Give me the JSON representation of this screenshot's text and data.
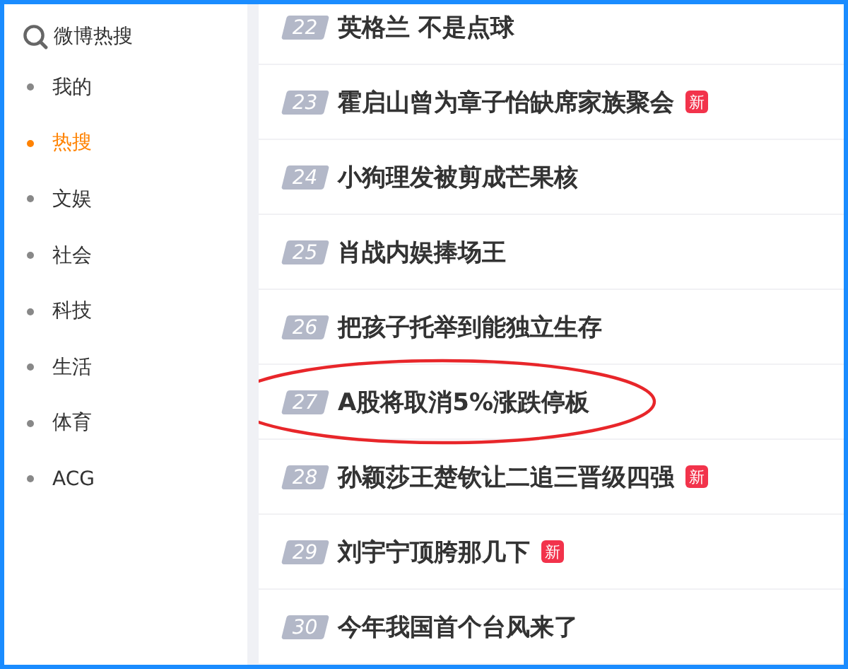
{
  "sidebar": {
    "title": "微博热搜",
    "items": [
      {
        "label": "我的",
        "selected": false
      },
      {
        "label": "热搜",
        "selected": true
      },
      {
        "label": "文娱",
        "selected": false
      },
      {
        "label": "社会",
        "selected": false
      },
      {
        "label": "科技",
        "selected": false
      },
      {
        "label": "生活",
        "selected": false
      },
      {
        "label": "体育",
        "selected": false
      },
      {
        "label": "ACG",
        "selected": false
      }
    ]
  },
  "hot_list": [
    {
      "rank": "22",
      "title": "英格兰 不是点球",
      "highlighted": false
    },
    {
      "rank": "23",
      "title": "霍启山曾为章子怡缺席家族聚会",
      "badge": "新",
      "highlighted": false
    },
    {
      "rank": "24",
      "title": "小狗理发被剪成芒果核",
      "highlighted": false
    },
    {
      "rank": "25",
      "title": "肖战内娱捧场王",
      "highlighted": false
    },
    {
      "rank": "26",
      "title": "把孩子托举到能独立生存",
      "highlighted": false
    },
    {
      "rank": "27",
      "title": "A股将取消5%涨跌停板",
      "highlighted": true
    },
    {
      "rank": "28",
      "title": "孙颖莎王楚钦让二追三晋级四强",
      "badge": "新",
      "highlighted": false
    },
    {
      "rank": "29",
      "title": "刘宇宁顶胯那几下",
      "badge": "新",
      "highlighted": false
    },
    {
      "rank": "30",
      "title": "今年我国首个台风来了",
      "highlighted": false
    }
  ]
}
